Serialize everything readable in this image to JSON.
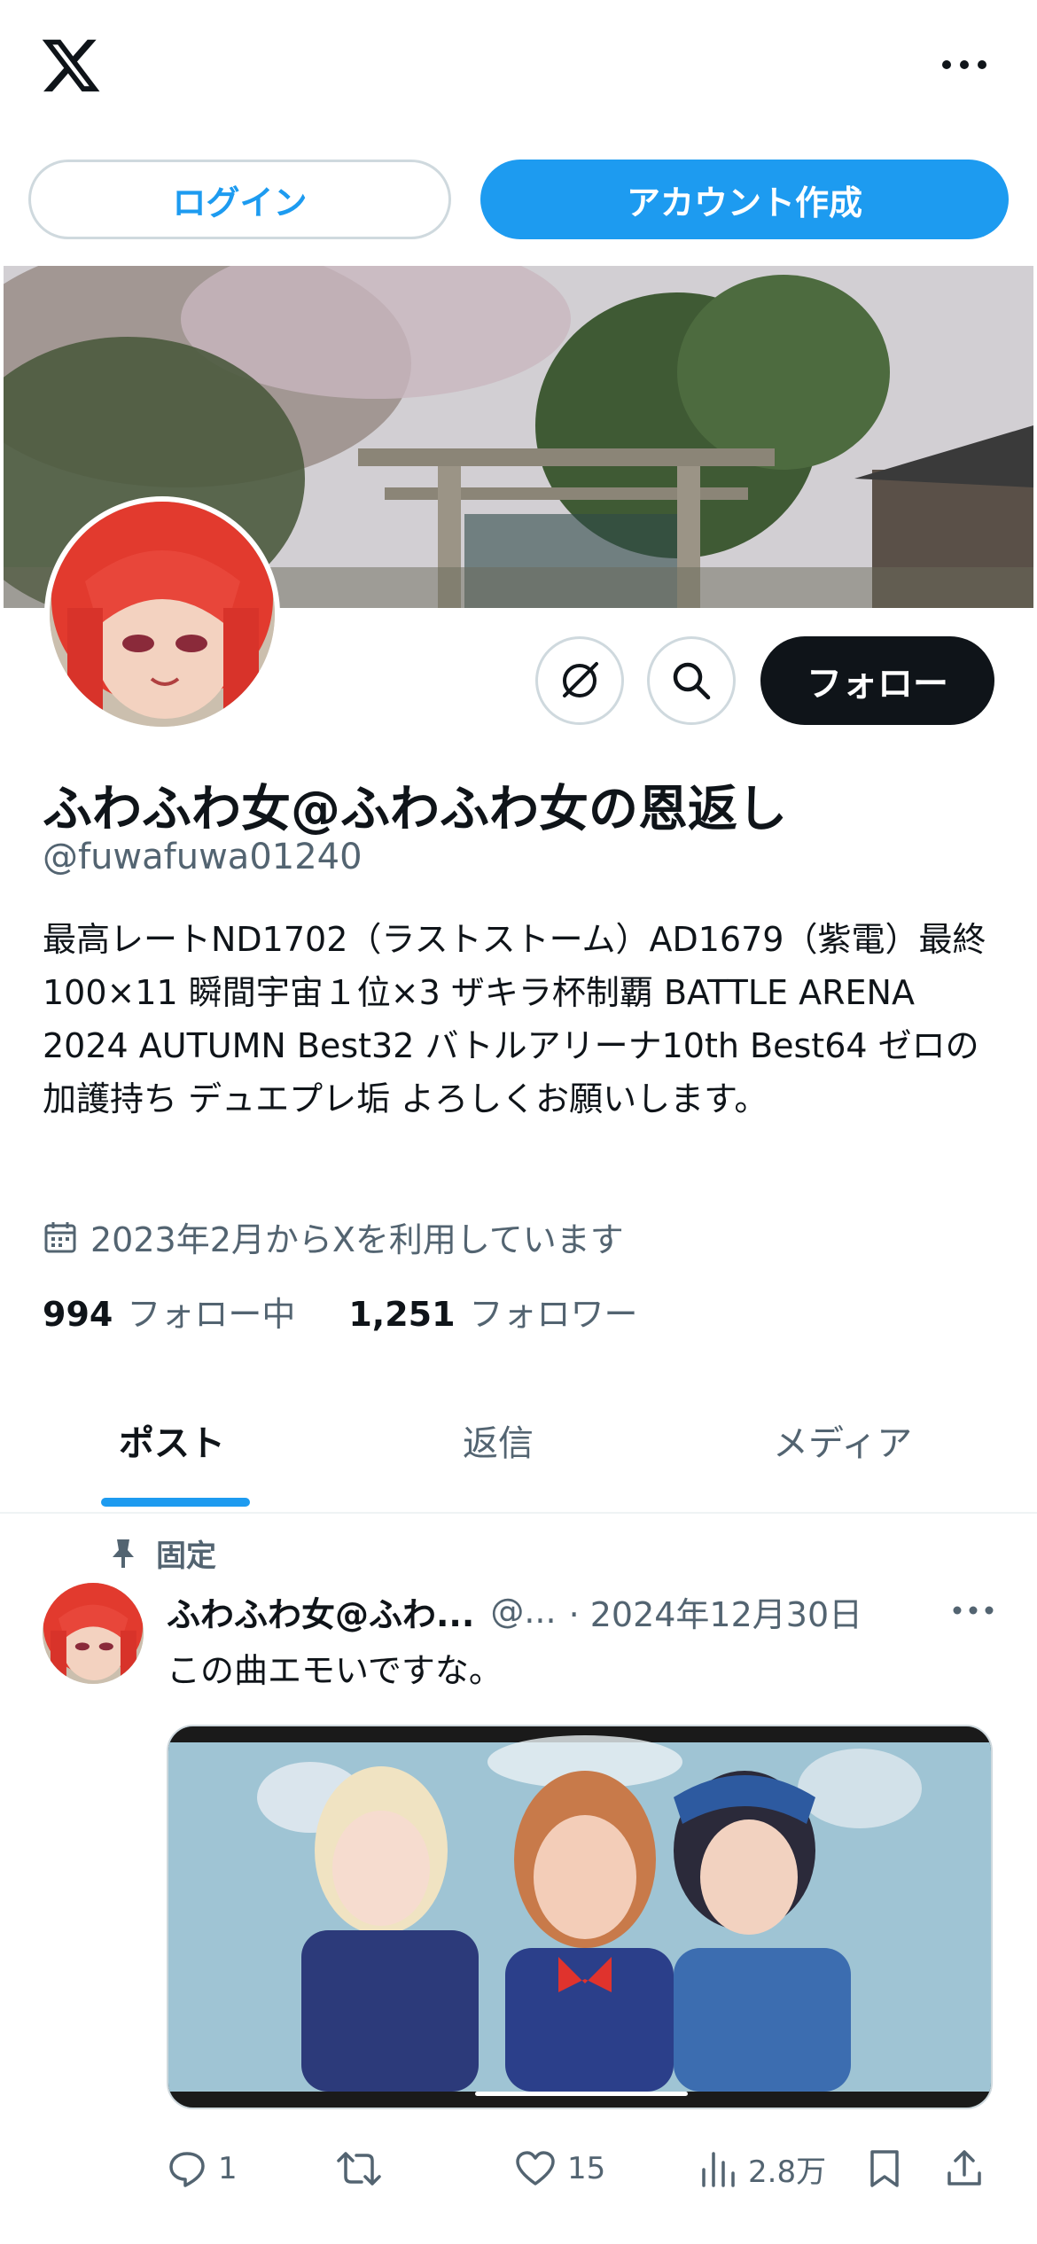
{
  "header": {
    "logo": "x-logo-icon",
    "more_icon": "more-horizontal-icon",
    "login_label": "ログイン",
    "signup_label": "アカウント作成"
  },
  "profile": {
    "display_name": "ふわふわ女@ふわふわ女の恩返し",
    "handle": "@fuwafuwa01240",
    "bio": "最高レートND1702（ラストストーム）AD1679（紫電）最終100×11 瞬間宇宙１位×3 ザキラ杯制覇 BATTLE ARENA 2024 AUTUMN Best32 バトルアリーナ10th Best64 ゼロの加護持ち デュエプレ垢 よろしくお願いします。",
    "joined": "2023年2月からXを利用しています",
    "following_count": "994",
    "following_label": "フォロー中",
    "followers_count": "1,251",
    "followers_label": "フォロワー",
    "follow_label": "フォロー",
    "grok_icon": "grok-icon",
    "search_icon": "search-icon"
  },
  "tabs": [
    {
      "label": "ポスト",
      "active": true
    },
    {
      "label": "返信",
      "active": false
    },
    {
      "label": "メディア",
      "active": false
    }
  ],
  "post": {
    "pinned_label": "固定",
    "author_name": "ふわふわ女@ふわ...",
    "author_handle": "@...",
    "date": "· 2024年12月30日",
    "text": "この曲エモいですな。",
    "replies": "1",
    "reposts": "",
    "likes": "15",
    "views": "2.8万"
  },
  "colors": {
    "accent": "#1d9bf0",
    "text": "#0f1419",
    "muted": "#536471",
    "border": "#cfd9de"
  }
}
